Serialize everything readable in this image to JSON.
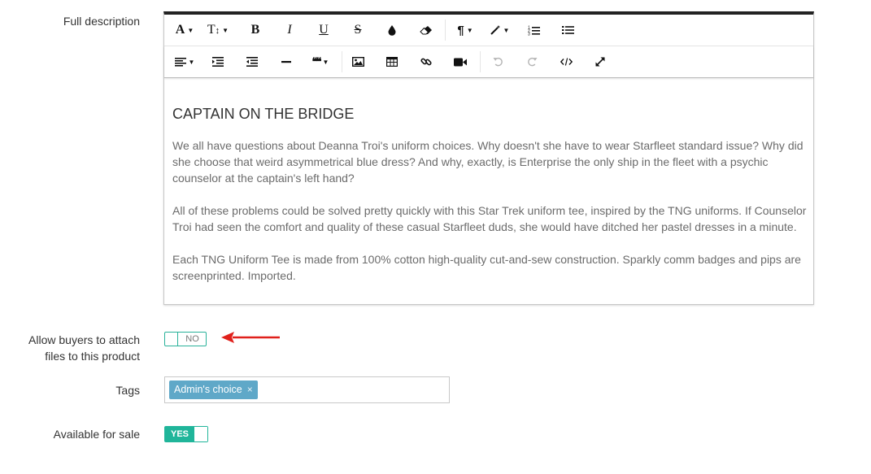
{
  "labels": {
    "full_description": "Full description",
    "attach_files_line1": "Allow buyers to attach",
    "attach_files_line2": "files to this product",
    "tags": "Tags",
    "available_for_sale": "Available for sale"
  },
  "toolbar": {
    "row1": [
      "font-icon",
      "font-size-icon",
      "bold-icon",
      "italic-icon",
      "underline-icon",
      "strikethrough-icon",
      "color-icon",
      "eraser-icon",
      "paragraph-icon",
      "magic-icon",
      "ordered-list-icon",
      "unordered-list-icon"
    ],
    "row2": [
      "align-icon",
      "indent-icon",
      "outdent-icon",
      "horizontal-rule-icon",
      "quote-icon",
      "image-icon",
      "table-icon",
      "link-icon",
      "video-icon",
      "undo-icon",
      "redo-icon",
      "code-view-icon",
      "fullscreen-icon"
    ],
    "glyphs": {
      "font": "A",
      "size": "T",
      "bold": "B",
      "italic": "I",
      "underline": "U",
      "strike": "S",
      "paragraph": "¶",
      "quote": "❝❝"
    }
  },
  "editor": {
    "heading": "CAPTAIN ON THE BRIDGE",
    "paragraphs": [
      "We all have questions about Deanna Troi's uniform choices. Why doesn't she have to wear Starfleet standard issue? Why did she choose that weird asymmetrical blue dress? And why, exactly, is Enterprise the only ship in the fleet with a psychic counselor at the captain's left hand?",
      "All of these problems could be solved pretty quickly with this Star Trek uniform tee, inspired by the TNG uniforms. If Counselor Troi had seen the comfort and quality of these casual Starfleet duds, she would have ditched her pastel dresses in a minute.",
      "Each TNG Uniform Tee is made from 100% cotton high-quality cut-and-sew construction. Sparkly comm badges and pips are screenprinted. Imported."
    ]
  },
  "attach_switch": {
    "state_label": "NO",
    "color": "#2ab29b"
  },
  "tags": {
    "items": [
      {
        "label": "Admin's choice",
        "remove": "×"
      }
    ],
    "tag_color": "#5fa8c8"
  },
  "sale_switch": {
    "state_label": "YES",
    "color": "#20b59a"
  },
  "annotation": {
    "arrow_color": "#e0201b"
  }
}
